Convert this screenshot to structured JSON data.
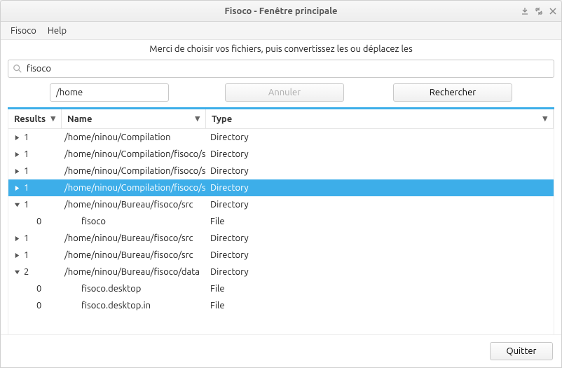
{
  "window": {
    "title": "Fisoco - Fenêtre principale"
  },
  "menubar": {
    "items": [
      "Fisoco",
      "Help"
    ]
  },
  "instruction": "Merci de choisir vos fichiers, puis convertissez les ou déplacez les",
  "search": {
    "value": "fisoco"
  },
  "path_input": {
    "value": "/home"
  },
  "buttons": {
    "cancel": "Annuler",
    "search": "Rechercher",
    "quit": "Quitter"
  },
  "columns": {
    "results": "Results",
    "name": "Name",
    "type": "Type"
  },
  "rows": [
    {
      "expander": "right",
      "count": "1",
      "name": "/home/ninou/Compilation",
      "type": "Directory",
      "child": false,
      "selected": false
    },
    {
      "expander": "right",
      "count": "1",
      "name": "/home/ninou/Compilation/fisoco/src",
      "type": "Directory",
      "child": false,
      "selected": false
    },
    {
      "expander": "right",
      "count": "1",
      "name": "/home/ninou/Compilation/fisoco/src",
      "type": "Directory",
      "child": false,
      "selected": false
    },
    {
      "expander": "right",
      "count": "1",
      "name": "/home/ninou/Compilation/fisoco/src",
      "type": "Directory",
      "child": false,
      "selected": true
    },
    {
      "expander": "down",
      "count": "1",
      "name": "/home/ninou/Bureau/fisoco/src",
      "type": "Directory",
      "child": false,
      "selected": false
    },
    {
      "expander": "",
      "count": "0",
      "name": "fisoco",
      "type": "File",
      "child": true,
      "selected": false
    },
    {
      "expander": "right",
      "count": "1",
      "name": "/home/ninou/Bureau/fisoco/src",
      "type": "Directory",
      "child": false,
      "selected": false
    },
    {
      "expander": "right",
      "count": "1",
      "name": "/home/ninou/Bureau/fisoco/src",
      "type": "Directory",
      "child": false,
      "selected": false
    },
    {
      "expander": "down",
      "count": "2",
      "name": "/home/ninou/Bureau/fisoco/data",
      "type": "Directory",
      "child": false,
      "selected": false
    },
    {
      "expander": "",
      "count": "0",
      "name": "fisoco.desktop",
      "type": "File",
      "child": true,
      "selected": false
    },
    {
      "expander": "",
      "count": "0",
      "name": "fisoco.desktop.in",
      "type": "File",
      "child": true,
      "selected": false
    }
  ]
}
